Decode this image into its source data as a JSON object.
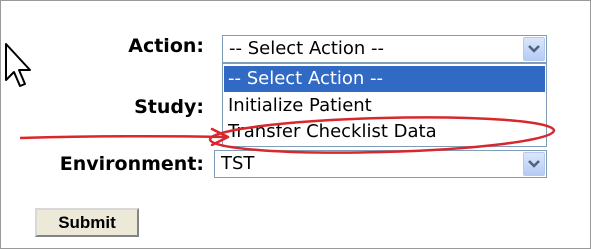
{
  "form": {
    "action": {
      "label": "Action:",
      "selected": "-- Select Action --",
      "options": [
        "-- Select Action --",
        "Initialize Patient",
        "Transfer Checklist Data"
      ]
    },
    "study": {
      "label": "Study:"
    },
    "environment": {
      "label": "Environment:",
      "selected": "TST"
    },
    "submit_label": "Submit"
  },
  "colors": {
    "highlight": "#316ac5",
    "annotation": "#d8282c"
  },
  "icons": [
    "mouse-pointer-icon",
    "chevron-down-icon"
  ]
}
